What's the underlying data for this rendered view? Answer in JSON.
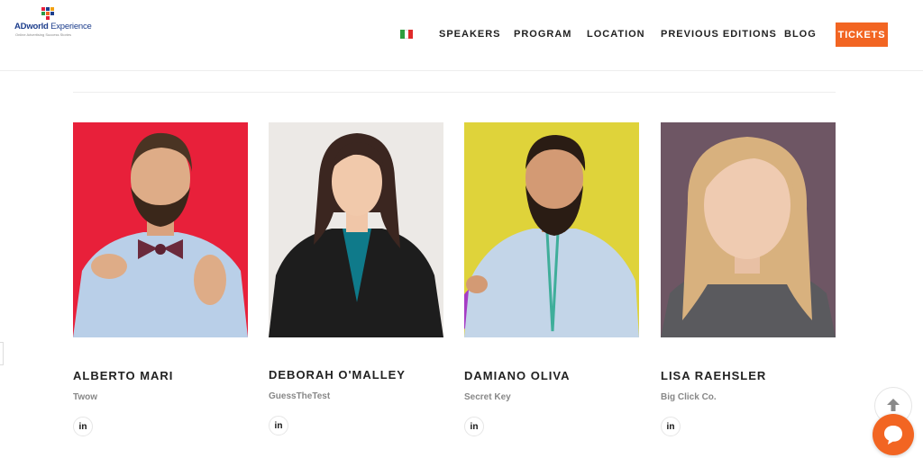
{
  "brand": {
    "name_bold": "ADworld",
    "name_rest": " Experience",
    "tagline": "Online Advertising Success Stories"
  },
  "nav": {
    "language_icon": "italian-flag-icon",
    "items": [
      {
        "label": "SPEAKERS"
      },
      {
        "label": "PROGRAM"
      },
      {
        "label": "LOCATION"
      },
      {
        "label": "PREVIOUS EDITIONS"
      },
      {
        "label": "BLOG"
      }
    ],
    "cta_label": "TICKETS",
    "accent_color": "#f26522"
  },
  "speakers": [
    {
      "name": "ALBERTO MARI",
      "company": "Twow",
      "social": "in",
      "bg_color": "#e8203a"
    },
    {
      "name": "DEBORAH O'MALLEY",
      "company": "GuessTheTest",
      "social": "in",
      "bg_color": "#ece9e6"
    },
    {
      "name": "DAMIANO OLIVA",
      "company": "Secret Key",
      "social": "in",
      "bg_color": "#dfd33a"
    },
    {
      "name": "LISA RAEHSLER",
      "company": "Big Click Co.",
      "social": "in",
      "bg_color": "#6e5664"
    }
  ],
  "widgets": {
    "scroll_top_icon": "arrow-up-icon",
    "chat_icon": "chat-bubble-icon"
  }
}
